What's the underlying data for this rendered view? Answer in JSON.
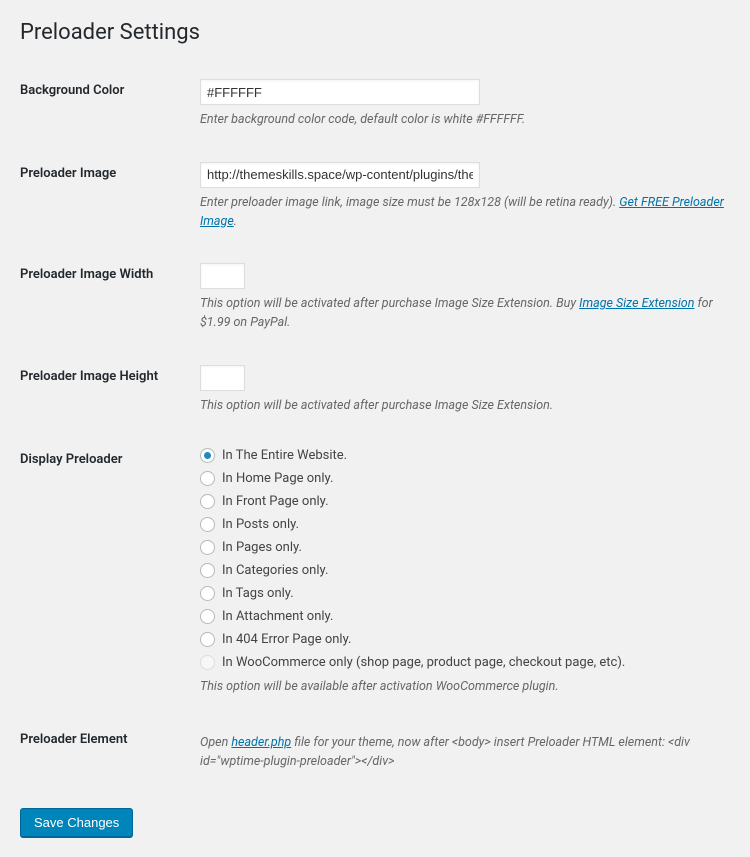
{
  "page": {
    "title": "Preloader Settings"
  },
  "fields": {
    "background_color": {
      "label": "Background Color",
      "value": "#FFFFFF",
      "description": "Enter background color code, default color is white #FFFFFF."
    },
    "preloader_image": {
      "label": "Preloader Image",
      "value": "http://themeskills.space/wp-content/plugins/the-prelo",
      "desc_pre": "Enter preloader image link, image size must be 128x128 (will be retina ready). ",
      "link_text": "Get FREE Preloader Image",
      "desc_post": "."
    },
    "preloader_image_width": {
      "label": "Preloader Image Width",
      "value": "",
      "desc_pre": "This option will be activated after purchase Image Size Extension. Buy ",
      "link_text": "Image Size Extension",
      "desc_post": " for $1.99 on PayPal."
    },
    "preloader_image_height": {
      "label": "Preloader Image Height",
      "value": "",
      "description": "This option will be activated after purchase Image Size Extension."
    },
    "display_preloader": {
      "label": "Display Preloader",
      "options": {
        "entire": "In The Entire Website.",
        "home": "In Home Page only.",
        "front": "In Front Page only.",
        "posts": "In Posts only.",
        "pages": "In Pages only.",
        "categories": "In Categories only.",
        "tags": "In Tags only.",
        "attachment": "In Attachment only.",
        "error404": "In 404 Error Page only.",
        "woocommerce": "In WooCommerce only (shop page, product page, checkout page, etc)."
      },
      "woocommerce_note": "This option will be available after activation WooCommerce plugin."
    },
    "preloader_element": {
      "label": "Preloader Element",
      "desc_pre": "Open ",
      "link_text": "header.php",
      "desc_post": " file for your theme, now after <body> insert Preloader HTML element: <div id=\"wptime-plugin-preloader\"></div>"
    }
  },
  "submit": {
    "label": "Save Changes"
  }
}
